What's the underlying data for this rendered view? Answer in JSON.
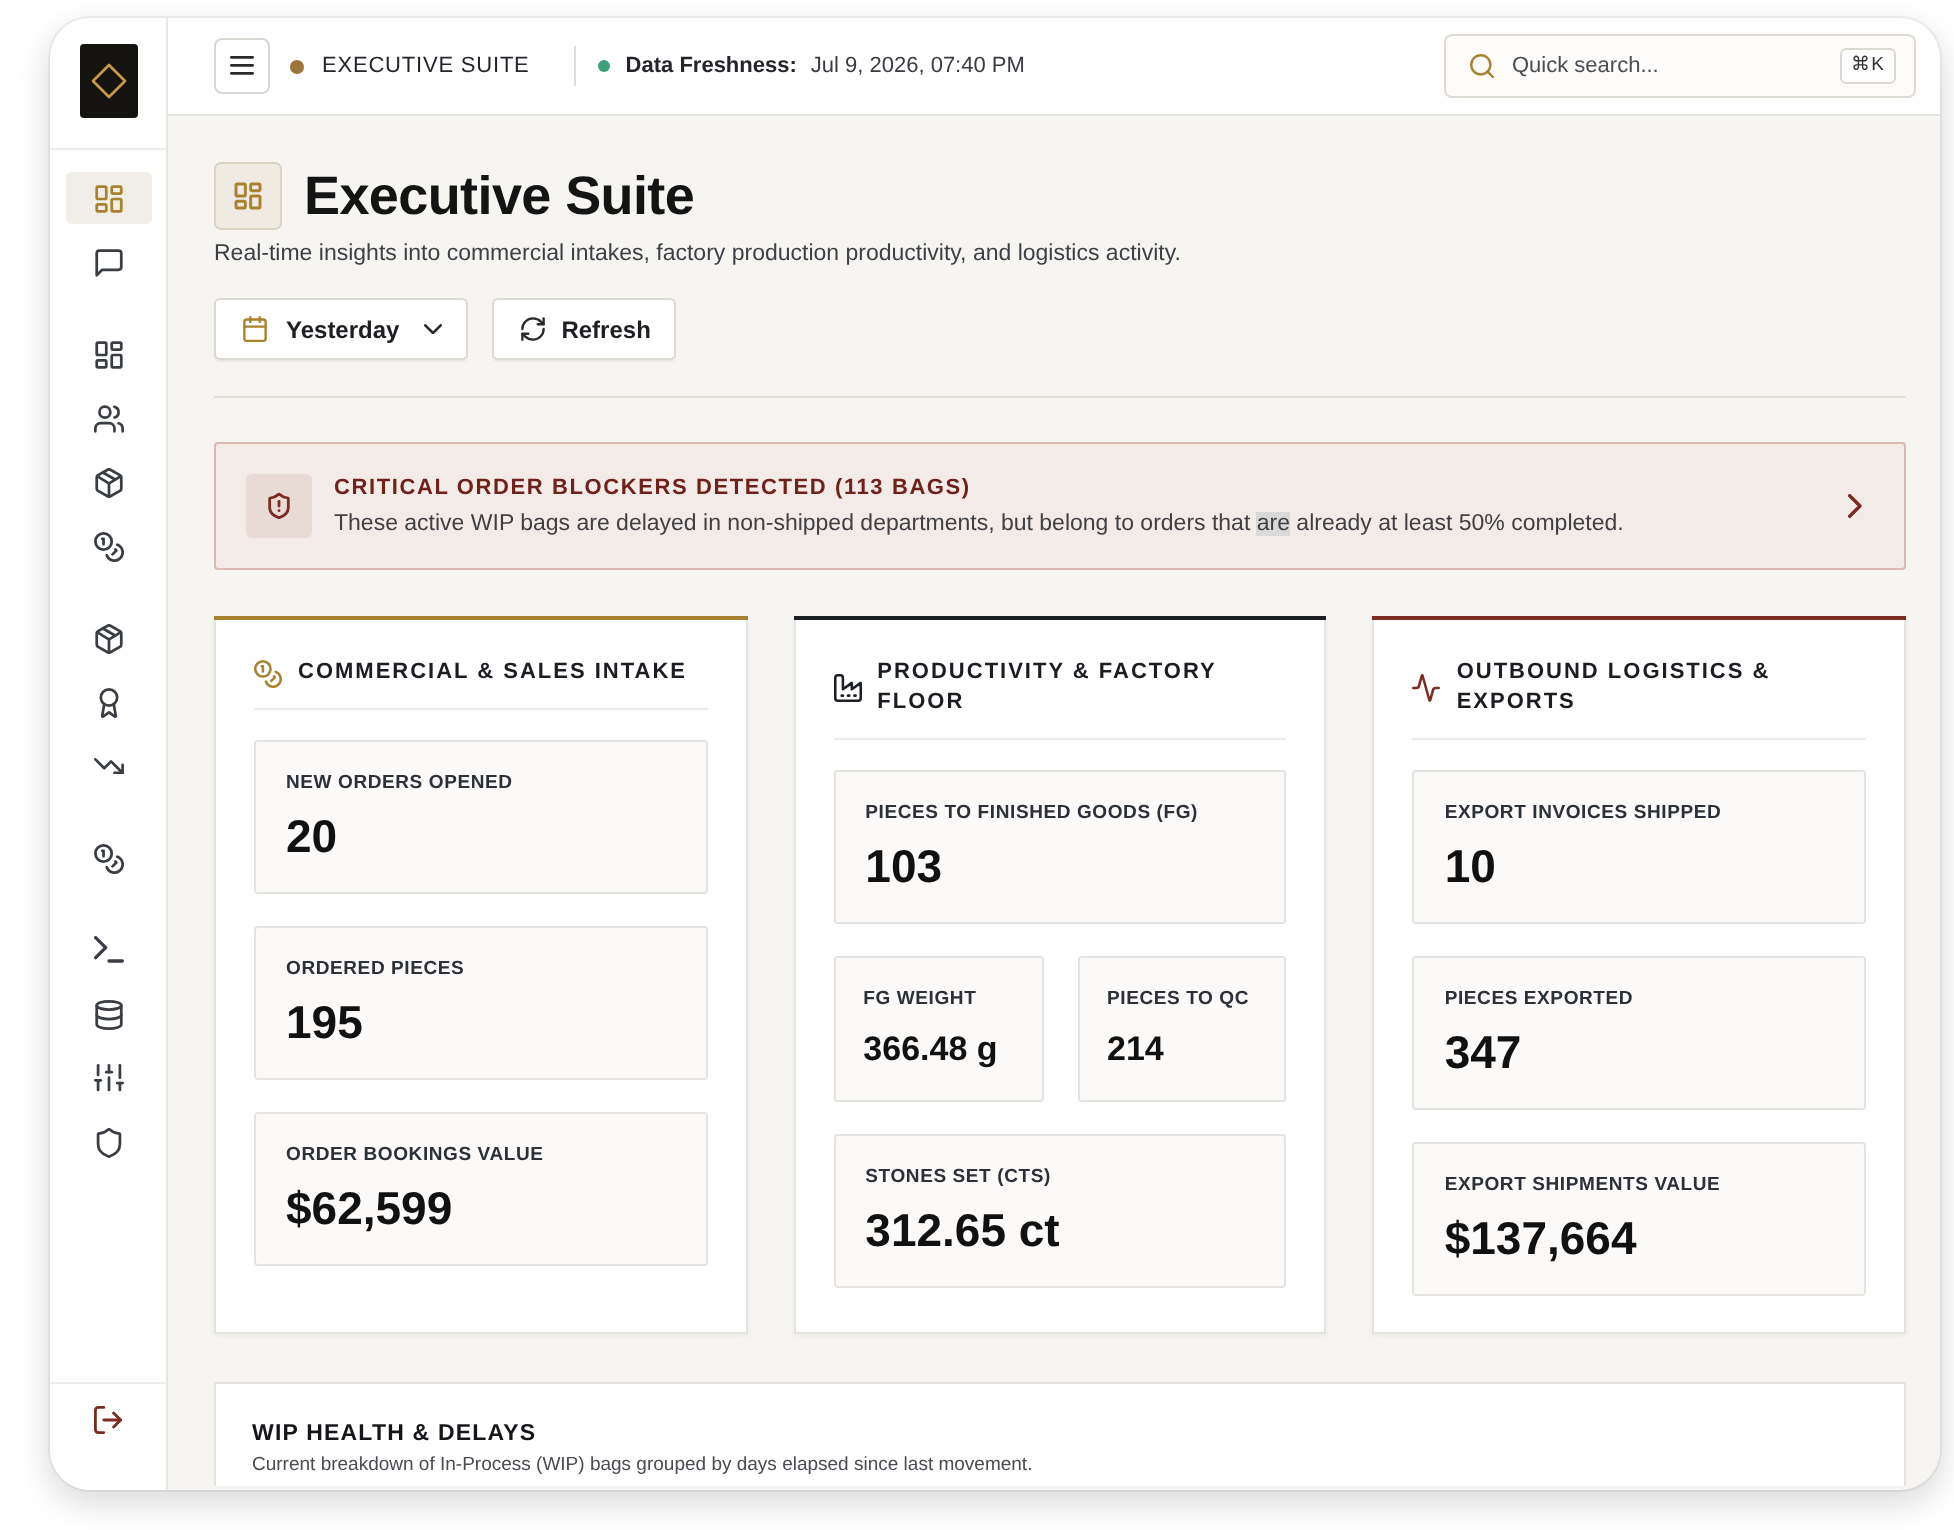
{
  "sidebar": {
    "groups": [
      {
        "items": [
          {
            "selected": true
          },
          {
            "selected": false
          }
        ]
      },
      {
        "items": [
          {
            "selected": false
          },
          {
            "selected": false
          },
          {
            "selected": false
          },
          {
            "selected": false
          }
        ]
      },
      {
        "items": [
          {
            "selected": false
          },
          {
            "selected": false
          },
          {
            "selected": false
          }
        ]
      },
      {
        "items": [
          {
            "selected": false
          }
        ]
      },
      {
        "items": [
          {
            "selected": false
          },
          {
            "selected": false
          },
          {
            "selected": false
          },
          {
            "selected": false
          }
        ]
      }
    ]
  },
  "header": {
    "breadcrumb": "EXECUTIVE SUITE",
    "freshness_label": "Data Freshness:",
    "freshness_value": "Jul 9, 2026, 07:40 PM",
    "search": {
      "placeholder": "Quick search...",
      "shortcut": "⌘K"
    }
  },
  "page": {
    "title": "Executive Suite",
    "subtitle": "Real-time insights into commercial intakes, factory production productivity, and logistics activity.",
    "date_filter": "Yesterday",
    "refresh_button": "Refresh"
  },
  "alert": {
    "title": "CRITICAL ORDER BLOCKERS DETECTED (113 BAGS)",
    "description": [
      {
        "text": "These active WIP bags are delayed in non-shipped departments, but belong to orders that ",
        "highlighted": false
      },
      {
        "text": "are",
        "highlighted": true
      },
      {
        "text": " already at least 50% completed.",
        "highlighted": false
      }
    ]
  },
  "sections": [
    {
      "title": "COMMERCIAL & SALES INTAKE",
      "color": "#a8822f",
      "rows": [
        [
          {
            "label": "NEW ORDERS OPENED",
            "value": "20"
          }
        ],
        [
          {
            "label": "ORDERED PIECES",
            "value": "195"
          }
        ],
        [
          {
            "label": "ORDER BOOKINGS VALUE",
            "value": "$62,599"
          }
        ]
      ]
    },
    {
      "title": "PRODUCTIVITY & FACTORY FLOOR",
      "color": "#1c1f26",
      "rows": [
        [
          {
            "label": "PIECES TO FINISHED GOODS (FG)",
            "value": "103"
          }
        ],
        [
          {
            "label": "FG WEIGHT",
            "value": "366.48 g"
          },
          {
            "label": "PIECES TO QC",
            "value": "214"
          }
        ],
        [
          {
            "label": "STONES SET (CTS)",
            "value": "312.65 ct"
          }
        ]
      ]
    },
    {
      "title": "OUTBOUND LOGISTICS & EXPORTS",
      "color": "#7b2b22",
      "rows": [
        [
          {
            "label": "EXPORT INVOICES SHIPPED",
            "value": "10"
          }
        ],
        [
          {
            "label": "PIECES EXPORTED",
            "value": "347"
          }
        ],
        [
          {
            "label": "EXPORT SHIPMENTS VALUE",
            "value": "$137,664"
          }
        ]
      ]
    }
  ],
  "wip_panel": {
    "title": "WIP HEALTH & DELAYS",
    "subtitle": "Current breakdown of In-Process (WIP) bags grouped by days elapsed since last movement."
  }
}
